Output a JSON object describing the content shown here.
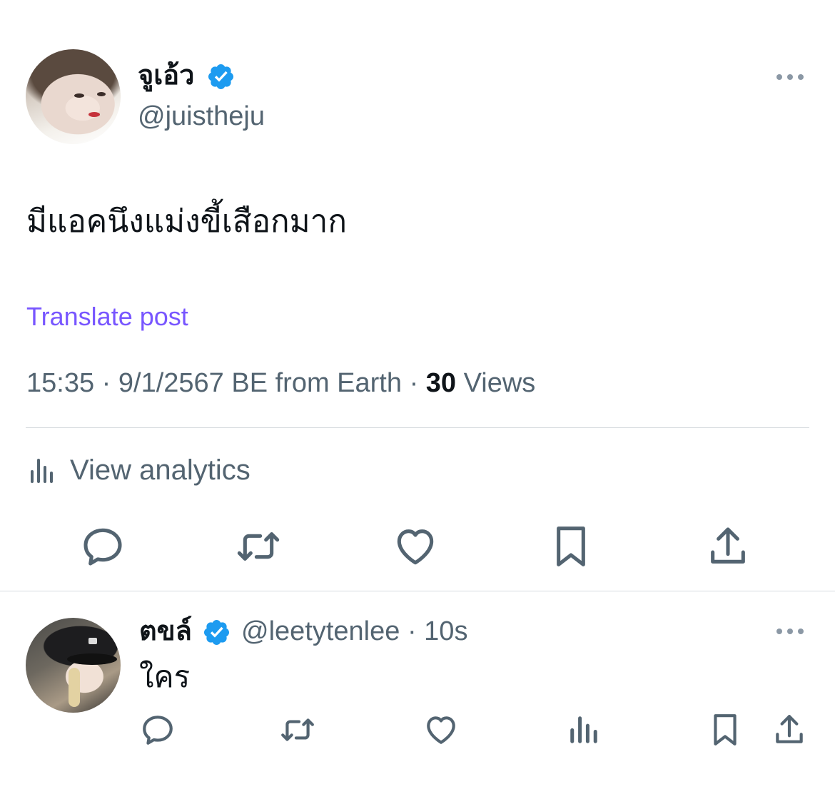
{
  "colors": {
    "text_primary": "#0f1419",
    "text_secondary": "#536471",
    "link": "#7856ff",
    "verified": "#1d9bf0",
    "divider": "#d6dbdf"
  },
  "post": {
    "display_name": "จูเอ้ว",
    "handle": "@juistheju",
    "text": "มีแอคนึงแม่งขี้เสือกมาก",
    "translate_label": "Translate post",
    "time": "15:35",
    "date": "9/1/2567 BE",
    "source": "from Earth",
    "views_count": "30",
    "views_label": "Views",
    "separator": "·",
    "analytics_label": "View analytics",
    "actions": [
      "reply-icon",
      "repost-icon",
      "like-icon",
      "bookmark-icon",
      "share-icon"
    ]
  },
  "reply": {
    "display_name": "ตขล์",
    "handle": "@leetytenlee",
    "separator": "·",
    "time_ago": "10s",
    "text": "ใคร",
    "actions": [
      "reply-icon",
      "repost-icon",
      "like-icon",
      "analytics-icon",
      "bookmark-icon",
      "share-icon"
    ]
  }
}
